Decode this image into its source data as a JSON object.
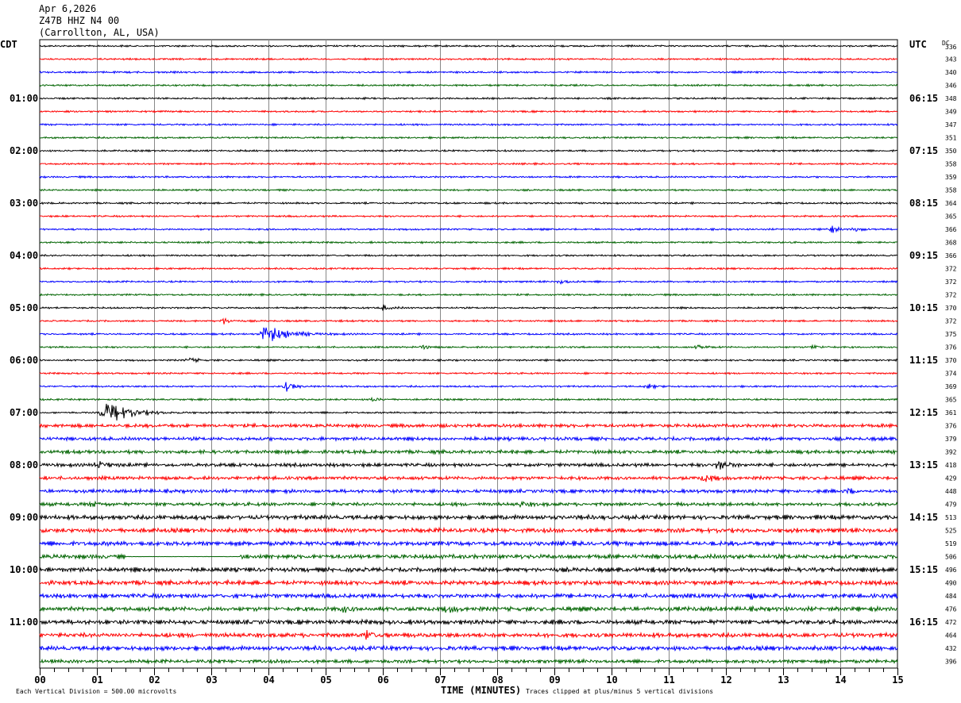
{
  "header": {
    "date": "Apr 6,2026",
    "station": "Z47B HHZ N4 00",
    "location": "(Carrollton, AL, USA)"
  },
  "chart_data": {
    "type": "line",
    "title": "Z47B HHZ N4 00 helicorder",
    "left_axis_label": "CDT",
    "right_axis_label": "UTC",
    "dc_label": "DC",
    "xlabel": "TIME (MINUTES)",
    "xlim": [
      0,
      15
    ],
    "x_ticks": [
      "00",
      "01",
      "02",
      "03",
      "04",
      "05",
      "06",
      "07",
      "08",
      "09",
      "10",
      "11",
      "12",
      "13",
      "14",
      "15"
    ],
    "minor_ticks_per_minute": 4,
    "left_hour_labels": [
      "01:00",
      "02:00",
      "03:00",
      "04:00",
      "05:00",
      "06:00",
      "07:00",
      "08:00",
      "09:00",
      "10:00",
      "11:00"
    ],
    "right_hour_labels": [
      "06:15",
      "07:15",
      "08:15",
      "09:15",
      "10:15",
      "11:15",
      "12:15",
      "13:15",
      "14:15",
      "15:15",
      "16:15"
    ],
    "trace_colors": [
      "#000000",
      "#ff0000",
      "#0000ff",
      "#006400"
    ],
    "trace_count": 48,
    "dc_offsets": [
      336,
      343,
      340,
      346,
      348,
      349,
      347,
      351,
      350,
      358,
      359,
      358,
      364,
      365,
      366,
      368,
      366,
      372,
      372,
      372,
      370,
      372,
      375,
      376,
      370,
      374,
      369,
      365,
      361,
      376,
      379,
      392,
      418,
      429,
      448,
      479,
      513,
      525,
      519,
      506,
      496,
      490,
      484,
      476,
      472,
      464,
      432,
      396
    ],
    "events": [
      {
        "trace": 14,
        "minute": 13.8,
        "amplitude_divisions": 0.6
      },
      {
        "trace": 14,
        "minute": 14.25,
        "amplitude_divisions": 0.4
      },
      {
        "trace": 18,
        "minute": 9.1,
        "amplitude_divisions": 0.4
      },
      {
        "trace": 20,
        "minute": 6.0,
        "amplitude_divisions": 0.4
      },
      {
        "trace": 21,
        "minute": 3.2,
        "amplitude_divisions": 0.6
      },
      {
        "trace": 22,
        "minute": 3.9,
        "amplitude_divisions": 1.6
      },
      {
        "trace": 23,
        "minute": 6.7,
        "amplitude_divisions": 0.4
      },
      {
        "trace": 23,
        "minute": 11.5,
        "amplitude_divisions": 0.4
      },
      {
        "trace": 23,
        "minute": 13.5,
        "amplitude_divisions": 0.4
      },
      {
        "trace": 24,
        "minute": 2.6,
        "amplitude_divisions": 0.5
      },
      {
        "trace": 26,
        "minute": 4.3,
        "amplitude_divisions": 0.8
      },
      {
        "trace": 26,
        "minute": 10.6,
        "amplitude_divisions": 0.4
      },
      {
        "trace": 27,
        "minute": 5.8,
        "amplitude_divisions": 0.4
      },
      {
        "trace": 28,
        "minute": 1.1,
        "amplitude_divisions": 2.2
      },
      {
        "trace": 32,
        "minute": 1.0,
        "amplitude_divisions": 0.8
      },
      {
        "trace": 32,
        "minute": 11.85,
        "amplitude_divisions": 1.2
      },
      {
        "trace": 33,
        "minute": 11.6,
        "amplitude_divisions": 0.8
      },
      {
        "trace": 34,
        "minute": 14.1,
        "amplitude_divisions": 0.4
      },
      {
        "trace": 35,
        "minute": 0.9,
        "amplitude_divisions": 0.4
      },
      {
        "trace": 35,
        "minute": 8.4,
        "amplitude_divisions": 0.4
      },
      {
        "trace": 42,
        "minute": 12.4,
        "amplitude_divisions": 0.4
      },
      {
        "trace": 43,
        "minute": 5.3,
        "amplitude_divisions": 0.4
      },
      {
        "trace": 43,
        "minute": 7.1,
        "amplitude_divisions": 0.6
      },
      {
        "trace": 45,
        "minute": 5.7,
        "amplitude_divisions": 0.8
      }
    ],
    "flat_segments": [
      {
        "trace": 39,
        "from_minute": 1.5,
        "to_minute": 3.5
      }
    ],
    "footer_left": "Each Vertical Division =  500.00 microvolts",
    "footer_right": "Traces clipped at plus/minus 5 vertical divisions"
  }
}
